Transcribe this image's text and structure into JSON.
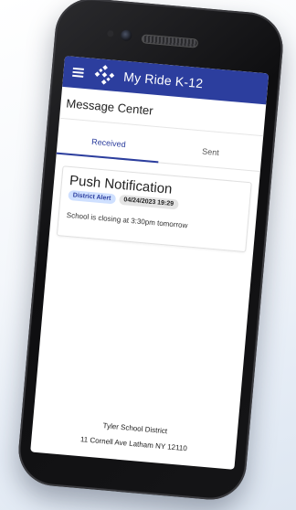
{
  "app": {
    "title": "My Ride K-12"
  },
  "page": {
    "title": "Message Center"
  },
  "tabs": [
    {
      "label": "Received",
      "active": true
    },
    {
      "label": "Sent",
      "active": false
    }
  ],
  "message": {
    "title": "Push Notification",
    "category_badge": "District Alert",
    "timestamp": "04/24/2023 19:29",
    "body": "School is closing at 3:30pm tomorrow"
  },
  "footer": {
    "district": "Tyler School District",
    "address": "11 Cornell Ave Latham NY 12110"
  },
  "colors": {
    "brand": "#2c3e9e",
    "badge_alert_bg": "#cfe0ff",
    "badge_date_bg": "#e4e4e4"
  },
  "icons": {
    "menu": "hamburger-menu-icon",
    "logo": "my-ride-logo-icon"
  }
}
